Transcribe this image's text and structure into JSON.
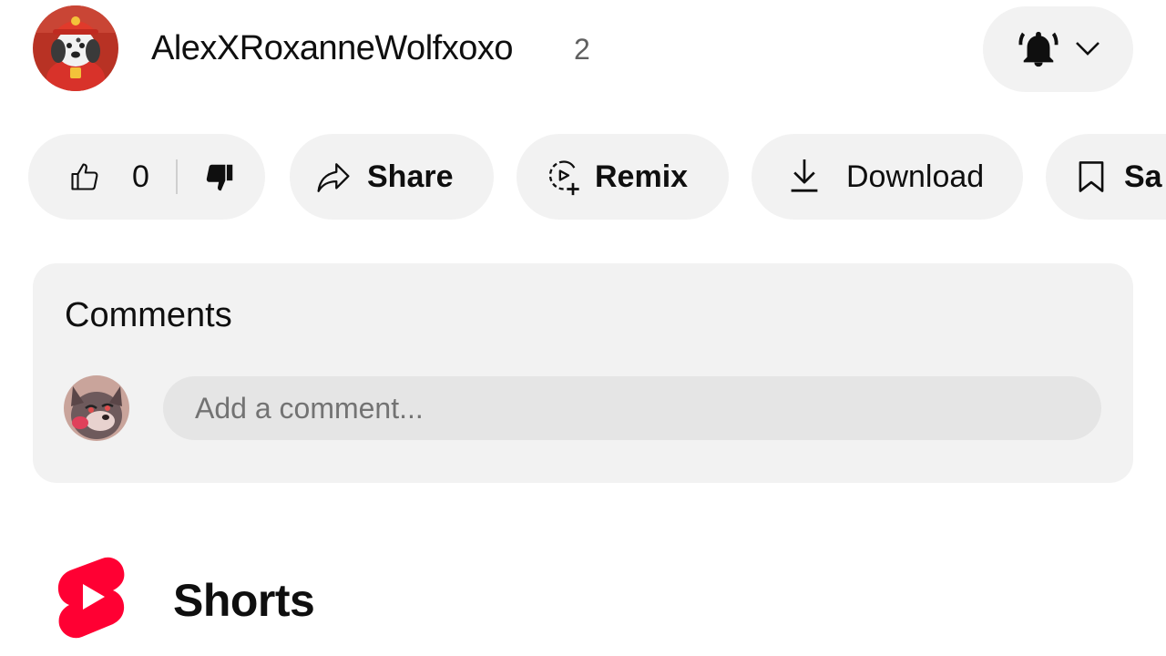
{
  "channel": {
    "name": "AlexXRoxanneWolfxoxo",
    "subscriber_count": "2",
    "avatar": "channel-avatar-dalmatian-firefighter",
    "notification_icon": "bell-filled-icon",
    "dropdown_icon": "chevron-down-icon"
  },
  "actions": {
    "like_count": "0",
    "like_icon": "thumbs-up-icon",
    "dislike_icon": "thumbs-down-filled-icon",
    "share_label": "Share",
    "share_icon": "share-arrow-icon",
    "remix_label": "Remix",
    "remix_icon": "remix-icon",
    "download_label": "Download",
    "download_icon": "download-icon",
    "save_label": "Sa",
    "save_icon": "bookmark-icon"
  },
  "comments": {
    "title": "Comments",
    "input_placeholder": "Add a comment...",
    "user_avatar": "user-avatar-cartoon-wolf"
  },
  "shorts": {
    "title": "Shorts",
    "logo_icon": "shorts-logo-icon"
  },
  "colors": {
    "pill_background": "#f2f2f2",
    "input_background": "#e5e5e5",
    "text_primary": "#0f0f0f",
    "text_secondary": "#606060",
    "shorts_red": "#ff0033"
  }
}
